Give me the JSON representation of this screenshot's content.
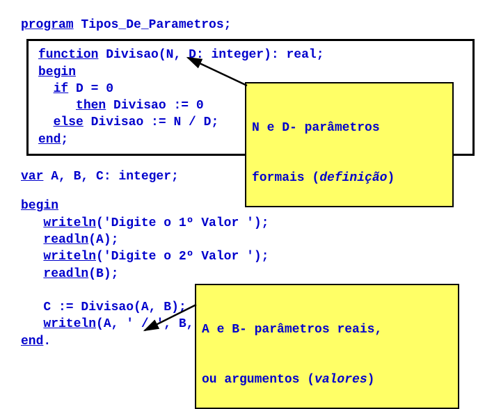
{
  "header": {
    "kw_program": "program",
    "program_name": " Tipos_De_Parametros;"
  },
  "func": {
    "l1a": "function",
    "l1b": " Divisao(",
    "l1c": "N",
    "l1d": ", ",
    "l1e": "D: integer",
    "l1f": "): ",
    "l1g": "real",
    "l1h": ";",
    "l2": "begin",
    "l3a": "  ",
    "l3b": "if",
    "l3c": " D = 0",
    "l4a": "     ",
    "l4b": "then",
    "l4c": " Divisao := 0",
    "l5a": "  ",
    "l5b": "else",
    "l5c": " Divisao := N / D;",
    "l6a": "end",
    "l6b": ";"
  },
  "callout1": {
    "t1": "N e D",
    "t2": "- parâmetros",
    "t3": "formais (",
    "t4": "definição",
    "t5": ")"
  },
  "vars": {
    "kw_var": "var",
    "rest": " A, B, C: integer;"
  },
  "main": {
    "kw_begin": "begin",
    "w1a": "   ",
    "w1b": "writeln",
    "w1c": "('Digite o 1º Valor ');",
    "r1a": "   ",
    "r1b": "readln",
    "r1c": "(A);",
    "w2a": "   ",
    "w2b": "writeln",
    "w2c": "('Digite o 2º Valor ');",
    "r2a": "   ",
    "r2b": "readln",
    "r2c": "(B);",
    "ca": "   C := Divisao(",
    "cb": "A",
    "cc": ", ",
    "cd": "B",
    "ce": ");",
    "w3a": "   ",
    "w3b": "writeln",
    "w3c": "(A, ' / ', B, ' = ', C);",
    "end_a": "end",
    "end_b": "."
  },
  "callout2": {
    "t1": "A e B",
    "t2": "- parâmetros reais,",
    "t3": "ou argumentos (",
    "t4": "valores",
    "t5": ")"
  }
}
